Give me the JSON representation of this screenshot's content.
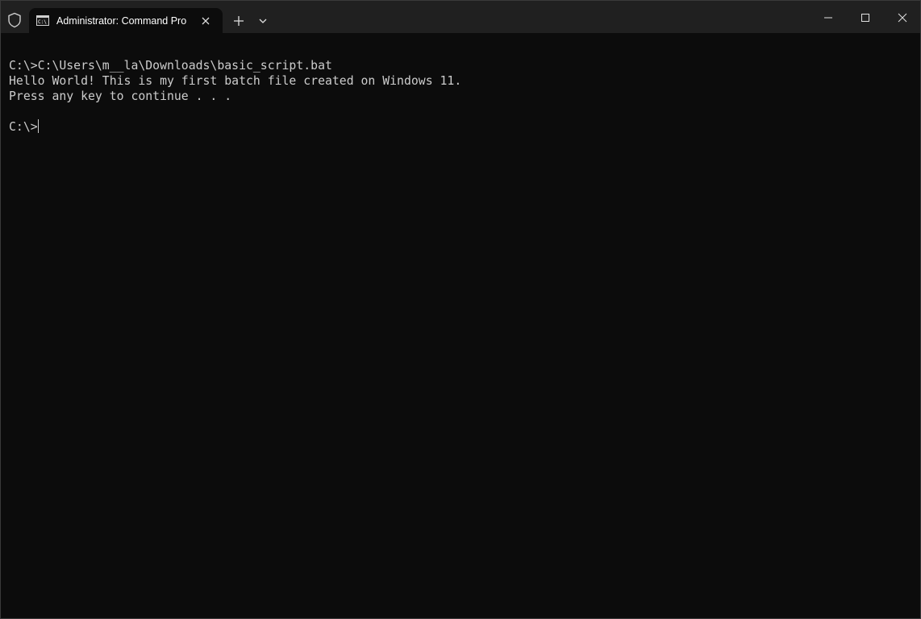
{
  "window": {
    "tab_title": "Administrator: Command Pro"
  },
  "icons": {
    "shield": "shield-icon",
    "tab": "cmd-icon",
    "tab_close": "close-icon",
    "new_tab": "plus-icon",
    "dropdown": "chevron-down-icon",
    "minimize": "minimize-icon",
    "maximize": "maximize-icon",
    "close": "close-icon"
  },
  "terminal": {
    "lines": [
      "C:\\>C:\\Users\\m__la\\Downloads\\basic_script.bat",
      "Hello World! This is my first batch file created on Windows 11.",
      "Press any key to continue . . .",
      "",
      "C:\\>"
    ]
  },
  "colors": {
    "background": "#0c0c0c",
    "titlebar": "#202020",
    "text": "#cccccc"
  }
}
